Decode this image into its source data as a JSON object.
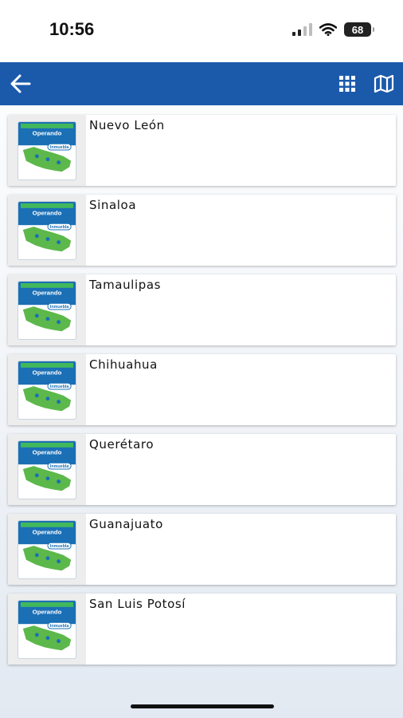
{
  "status_bar": {
    "time": "10:56",
    "battery": "68"
  },
  "app_bar": {
    "back_icon": "arrow-left-icon",
    "grid_icon": "grid-view-icon",
    "map_icon": "map-icon",
    "color": "#1b5aab"
  },
  "logo": {
    "label": "Operando",
    "brand": "Inmuebla"
  },
  "states": [
    {
      "name": "Nuevo León"
    },
    {
      "name": "Sinaloa"
    },
    {
      "name": "Tamaulipas"
    },
    {
      "name": "Chihuahua"
    },
    {
      "name": "Querétaro"
    },
    {
      "name": "Guanajuato"
    },
    {
      "name": "San Luis Potosí"
    }
  ]
}
